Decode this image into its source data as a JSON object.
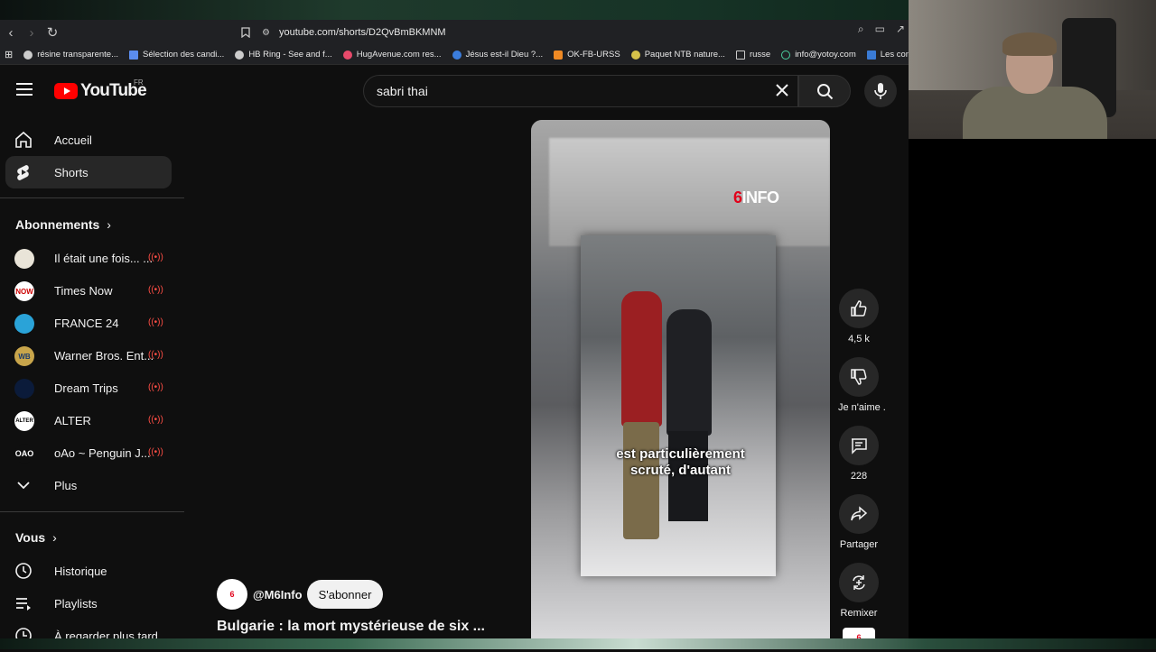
{
  "browser": {
    "url": "youtube.com/shorts/D2QvBmBKMNM",
    "bookmarks": [
      {
        "label": "résine transparente..."
      },
      {
        "label": "Sélection des candi..."
      },
      {
        "label": "HB Ring - See and f..."
      },
      {
        "label": "HugAvenue.com res..."
      },
      {
        "label": "Jésus est-il Dieu ?..."
      },
      {
        "label": "OK-FB-URSS"
      },
      {
        "label": "Paquet NTB nature..."
      },
      {
        "label": "russe"
      },
      {
        "label": "info@yotoy.com"
      },
      {
        "label": "Les concours d'au"
      }
    ]
  },
  "header": {
    "logo_text": "YouTube",
    "region": "FR",
    "search_value": "sabri thai"
  },
  "sidebar": {
    "main": [
      {
        "label": "Accueil"
      },
      {
        "label": "Shorts"
      }
    ],
    "subscriptions_title": "Abonnements",
    "subscriptions": [
      {
        "label": "Il était une fois... ...",
        "avatar": ""
      },
      {
        "label": "Times Now",
        "avatar": "NOW"
      },
      {
        "label": "FRANCE 24",
        "avatar": ""
      },
      {
        "label": "Warner Bros. Ent...",
        "avatar": "WB"
      },
      {
        "label": "Dream Trips",
        "avatar": ""
      },
      {
        "label": "ALTER",
        "avatar": "ALTER"
      },
      {
        "label": "oAo ~ Penguin J...",
        "avatar": "OAO"
      }
    ],
    "more_label": "Plus",
    "you_title": "Vous",
    "you_items": [
      {
        "label": "Historique"
      },
      {
        "label": "Playlists"
      },
      {
        "label": "À regarder plus tard"
      }
    ]
  },
  "video": {
    "watermark": "INFO",
    "caption_line1": "est particulièrement",
    "caption_line2": "scruté, d'autant",
    "channel": "@M6Info",
    "subscribe_label": "S'abonner",
    "title": "Bulgarie : la mort mystérieuse de six ..."
  },
  "actions": {
    "likes": "4,5 k",
    "dislike_label": "Je n'aime .",
    "comments": "228",
    "share_label": "Partager",
    "remix_label": "Remixer"
  },
  "colors": {
    "accent": "#ff0000",
    "live": "#ff4e45",
    "m6_red": "#e2001a"
  }
}
